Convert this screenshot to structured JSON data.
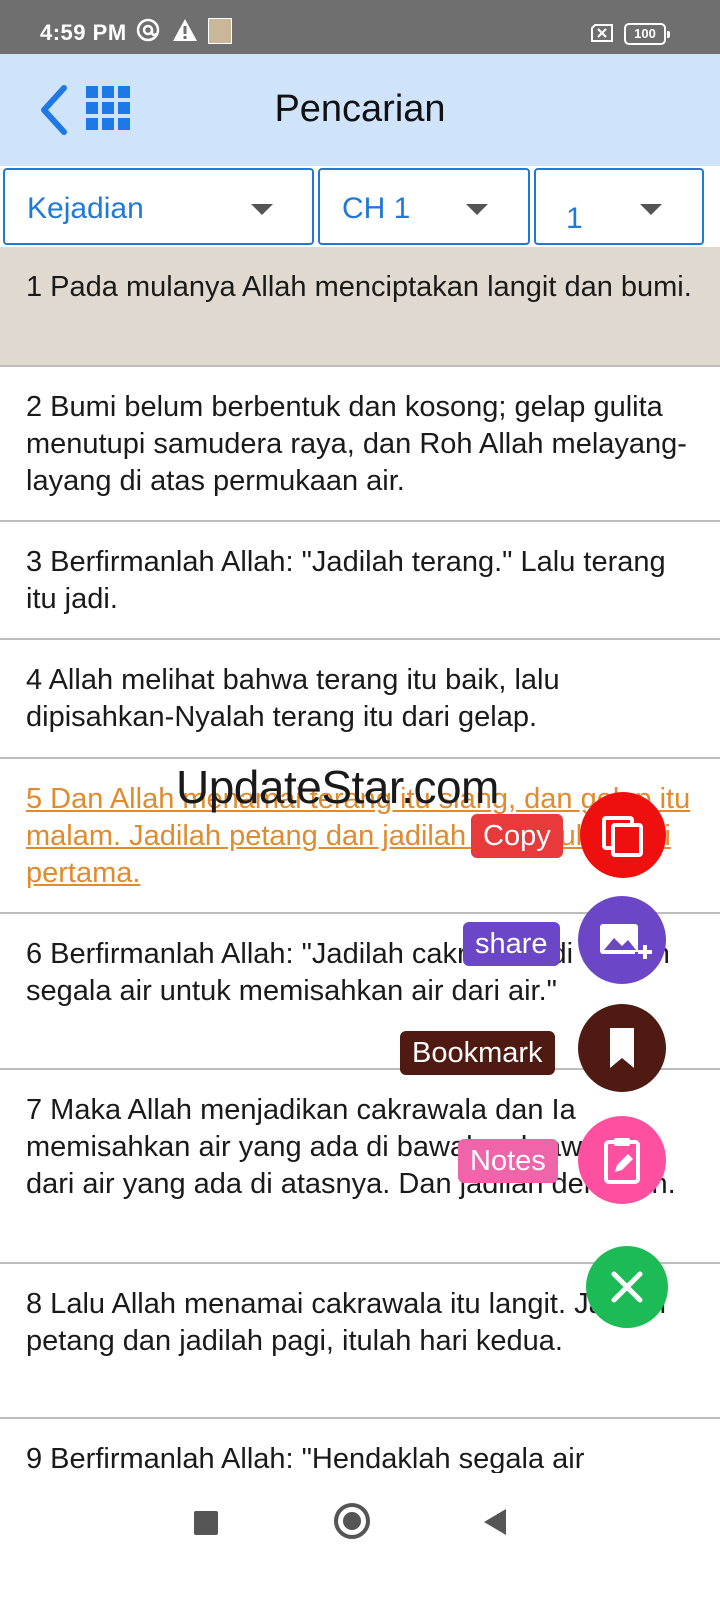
{
  "status_bar": {
    "time": "4:59 PM",
    "battery": "100"
  },
  "header": {
    "title": "Pencarian"
  },
  "selectors": {
    "book": "Kejadian",
    "chapter": "CH 1",
    "verse": "1"
  },
  "verses": [
    "1 Pada mulanya Allah menciptakan langit dan bumi.",
    "2 Bumi belum berbentuk dan kosong; gelap gulita menutupi samudera raya, dan Roh Allah melayang-layang di atas permukaan air.",
    "3 Berfirmanlah Allah: \"Jadilah terang.\" Lalu terang itu jadi.",
    "4 Allah melihat bahwa terang itu baik, lalu dipisahkan-Nyalah terang itu dari gelap.",
    "5 Dan Allah menamai terang itu siang, dan gelap itu malam. Jadilah petang dan jadilah pagi, itulah hari pertama.",
    "6 Berfirmanlah Allah: \"Jadilah cakrawala di tengah segala air untuk memisahkan air dari air.\"",
    "7 Maka Allah menjadikan cakrawala dan Ia memisahkan air yang ada di bawah cakrawala itu dari air yang ada di atasnya. Dan jadilah demikian.",
    "8 Lalu Allah menamai cakrawala itu langit. Jadilah petang dan jadilah pagi, itulah hari kedua.",
    "9 Berfirmanlah Allah: \"Hendaklah segala air"
  ],
  "watermark": "UpdateStar.com",
  "actions": {
    "copy": "Copy",
    "share": "share",
    "bookmark": "Bookmark",
    "notes": "Notes"
  },
  "colors": {
    "header_bg": "#cfe4fb",
    "accent_blue": "#1f79d6",
    "selected_verse": "#e08b2e",
    "highlight_bg": "#e0d9d0",
    "copy": "#f00f0f",
    "share": "#6b46c6",
    "bookmark": "#4f1a12",
    "notes": "#ff4fa0",
    "close": "#1dbb55"
  },
  "icons": {
    "back": "chevron-left-icon",
    "grid": "grid-icon",
    "copy": "copy-icon",
    "share": "add-photo-icon",
    "bookmark": "bookmark-icon",
    "notes": "clipboard-edit-icon",
    "close": "close-icon"
  }
}
